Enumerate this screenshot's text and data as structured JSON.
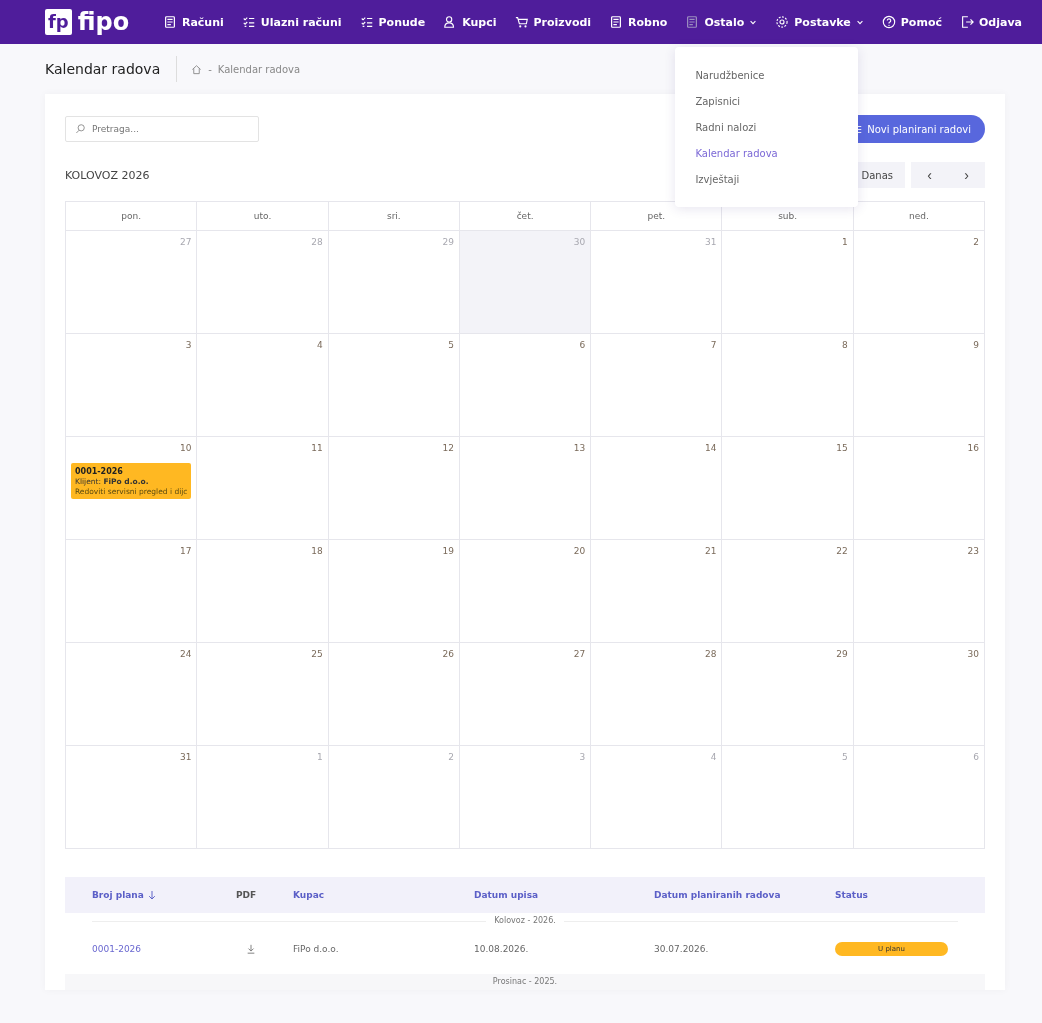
{
  "logo": {
    "mark": "fp",
    "name": "fipo"
  },
  "nav": [
    {
      "label": "Računi",
      "dropdown": false,
      "open": false
    },
    {
      "label": "Ulazni računi",
      "dropdown": false,
      "open": false
    },
    {
      "label": "Ponude",
      "dropdown": false,
      "open": false
    },
    {
      "label": "Kupci",
      "dropdown": false,
      "open": false
    },
    {
      "label": "Proizvodi",
      "dropdown": false,
      "open": false
    },
    {
      "label": "Robno",
      "dropdown": false,
      "open": false
    },
    {
      "label": "Ostalo",
      "dropdown": true,
      "open": true
    },
    {
      "label": "Postavke",
      "dropdown": true,
      "open": false
    },
    {
      "label": "Pomoć",
      "dropdown": false,
      "open": false
    },
    {
      "label": "Odjava",
      "dropdown": false,
      "open": false
    }
  ],
  "menu": [
    {
      "label": "Narudžbenice",
      "selected": false
    },
    {
      "label": "Zapisnici",
      "selected": false
    },
    {
      "label": "Radni nalozi",
      "selected": false
    },
    {
      "label": "Kalendar radova",
      "selected": true
    },
    {
      "label": "Izvještaji",
      "selected": false
    }
  ],
  "page_title": "Kalendar radova",
  "breadcrumb": {
    "separator": "-",
    "current": "Kalendar radova"
  },
  "search": {
    "placeholder": "Pretraga..."
  },
  "new_button": "Novi planirani radovi",
  "month_title": "KOLOVOZ 2026",
  "today_button": "Danas",
  "prev_button": "‹",
  "next_button": "›",
  "weekdays": [
    "pon.",
    "uto.",
    "sri.",
    "čet.",
    "pet.",
    "sub.",
    "ned."
  ],
  "weeks": [
    [
      {
        "day": "27",
        "muted": true,
        "today": false
      },
      {
        "day": "28",
        "muted": true,
        "today": false
      },
      {
        "day": "29",
        "muted": true,
        "today": false
      },
      {
        "day": "30",
        "muted": true,
        "today": true
      },
      {
        "day": "31",
        "muted": true,
        "today": false
      },
      {
        "day": "1",
        "muted": false,
        "today": false
      },
      {
        "day": "2",
        "muted": false,
        "today": false
      }
    ],
    [
      {
        "day": "3",
        "muted": false,
        "today": false
      },
      {
        "day": "4",
        "muted": false,
        "today": false
      },
      {
        "day": "5",
        "muted": false,
        "today": false
      },
      {
        "day": "6",
        "muted": false,
        "today": false
      },
      {
        "day": "7",
        "muted": false,
        "today": false
      },
      {
        "day": "8",
        "muted": false,
        "today": false
      },
      {
        "day": "9",
        "muted": false,
        "today": false
      }
    ],
    [
      {
        "day": "10",
        "muted": false,
        "today": false,
        "events": [
          {
            "number": "0001-2026",
            "client_label": "Klijent:",
            "client": "FiPo d.o.o.",
            "description": "Redoviti servisni pregled i dijc"
          }
        ]
      },
      {
        "day": "11",
        "muted": false,
        "today": false
      },
      {
        "day": "12",
        "muted": false,
        "today": false
      },
      {
        "day": "13",
        "muted": false,
        "today": false
      },
      {
        "day": "14",
        "muted": false,
        "today": false
      },
      {
        "day": "15",
        "muted": false,
        "today": false
      },
      {
        "day": "16",
        "muted": false,
        "today": false
      }
    ],
    [
      {
        "day": "17",
        "muted": false,
        "today": false
      },
      {
        "day": "18",
        "muted": false,
        "today": false
      },
      {
        "day": "19",
        "muted": false,
        "today": false
      },
      {
        "day": "20",
        "muted": false,
        "today": false
      },
      {
        "day": "21",
        "muted": false,
        "today": false
      },
      {
        "day": "22",
        "muted": false,
        "today": false
      },
      {
        "day": "23",
        "muted": false,
        "today": false
      }
    ],
    [
      {
        "day": "24",
        "muted": false,
        "today": false
      },
      {
        "day": "25",
        "muted": false,
        "today": false
      },
      {
        "day": "26",
        "muted": false,
        "today": false
      },
      {
        "day": "27",
        "muted": false,
        "today": false
      },
      {
        "day": "28",
        "muted": false,
        "today": false
      },
      {
        "day": "29",
        "muted": false,
        "today": false
      },
      {
        "day": "30",
        "muted": false,
        "today": false
      }
    ],
    [
      {
        "day": "31",
        "muted": false,
        "today": false
      },
      {
        "day": "1",
        "muted": true,
        "today": false
      },
      {
        "day": "2",
        "muted": true,
        "today": false
      },
      {
        "day": "3",
        "muted": true,
        "today": false
      },
      {
        "day": "4",
        "muted": true,
        "today": false
      },
      {
        "day": "5",
        "muted": true,
        "today": false
      },
      {
        "day": "6",
        "muted": true,
        "today": false
      }
    ]
  ],
  "table": {
    "columns": [
      {
        "label": "Broj plana",
        "sorted": true
      },
      {
        "label": "PDF",
        "sorted": false
      },
      {
        "label": "Kupac",
        "sorted": false
      },
      {
        "label": "Datum upisa",
        "sorted": false
      },
      {
        "label": "Datum planiranih radova",
        "sorted": false
      },
      {
        "label": "Status",
        "sorted": false
      }
    ],
    "groups": [
      {
        "title": "Kolovoz - 2026.",
        "rows": [
          {
            "number": "0001-2026",
            "client": "FiPo d.o.o.",
            "created": "10.08.2026.",
            "planned": "30.07.2026.",
            "status": "U planu"
          }
        ]
      },
      {
        "title": "Prosinac - 2025."
      }
    ]
  }
}
